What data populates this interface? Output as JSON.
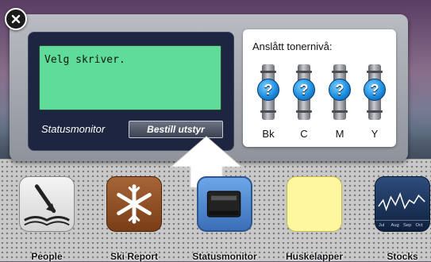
{
  "widget": {
    "screen_text": "Velg skriver.",
    "status_label": "Statusmonitor",
    "order_button": "Bestill utstyr",
    "toner": {
      "title": "Anslått tonernivå:",
      "cartridges": [
        {
          "label": "Bk",
          "symbol": "?"
        },
        {
          "label": "C",
          "symbol": "?"
        },
        {
          "label": "M",
          "symbol": "?"
        },
        {
          "label": "Y",
          "symbol": "?"
        }
      ]
    }
  },
  "dock": {
    "apps": [
      {
        "name": "People",
        "icon": "address-book-icon"
      },
      {
        "name": "Ski Report",
        "icon": "snowflake-icon"
      },
      {
        "name": "Statusmonitor",
        "icon": "printer-icon"
      },
      {
        "name": "Huskelapper",
        "icon": "sticky-note-icon"
      },
      {
        "name": "Stocks",
        "icon": "stocks-chart-icon"
      }
    ],
    "stocks_months": [
      "Jul",
      "Aug",
      "Sep",
      "Oct"
    ]
  },
  "colors": {
    "screen_green": "#5fdc99",
    "panel_dark": "#1d2540",
    "toner_blue": "#1e8ee0"
  }
}
